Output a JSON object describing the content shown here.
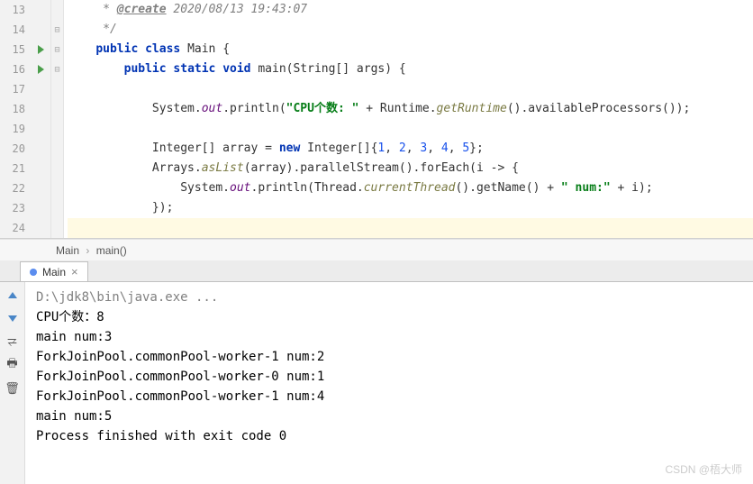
{
  "editor": {
    "lines": [
      {
        "n": 13,
        "run": false,
        "fold": "",
        "tokens": [
          {
            "t": "     * ",
            "c": "cmt"
          },
          {
            "t": "@create",
            "c": "anno"
          },
          {
            "t": " 2020/08/13 19:43:07",
            "c": "cmt"
          }
        ]
      },
      {
        "n": 14,
        "run": false,
        "fold": "⊟",
        "tokens": [
          {
            "t": "     */",
            "c": "cmt"
          }
        ]
      },
      {
        "n": 15,
        "run": true,
        "fold": "⊟",
        "tokens": [
          {
            "t": "    ",
            "c": ""
          },
          {
            "t": "public class ",
            "c": "kw"
          },
          {
            "t": "Main {",
            "c": "cls"
          }
        ]
      },
      {
        "n": 16,
        "run": true,
        "fold": "⊟",
        "tokens": [
          {
            "t": "        ",
            "c": ""
          },
          {
            "t": "public static void ",
            "c": "kw"
          },
          {
            "t": "main(String[] args) {",
            "c": "cls"
          }
        ]
      },
      {
        "n": 17,
        "run": false,
        "fold": "",
        "tokens": [
          {
            "t": "",
            "c": ""
          }
        ]
      },
      {
        "n": 18,
        "run": false,
        "fold": "",
        "tokens": [
          {
            "t": "            System.",
            "c": ""
          },
          {
            "t": "out",
            "c": "fld"
          },
          {
            "t": ".println(",
            "c": ""
          },
          {
            "t": "\"CPU个数: \"",
            "c": "str"
          },
          {
            "t": " + Runtime.",
            "c": ""
          },
          {
            "t": "getRuntime",
            "c": "mth"
          },
          {
            "t": "().availableProcessors());",
            "c": ""
          }
        ]
      },
      {
        "n": 19,
        "run": false,
        "fold": "",
        "tokens": [
          {
            "t": "",
            "c": ""
          }
        ]
      },
      {
        "n": 20,
        "run": false,
        "fold": "",
        "tokens": [
          {
            "t": "            Integer[] array = ",
            "c": ""
          },
          {
            "t": "new ",
            "c": "kw"
          },
          {
            "t": "Integer[]{",
            "c": ""
          },
          {
            "t": "1",
            "c": "num"
          },
          {
            "t": ", ",
            "c": ""
          },
          {
            "t": "2",
            "c": "num"
          },
          {
            "t": ", ",
            "c": ""
          },
          {
            "t": "3",
            "c": "num"
          },
          {
            "t": ", ",
            "c": ""
          },
          {
            "t": "4",
            "c": "num"
          },
          {
            "t": ", ",
            "c": ""
          },
          {
            "t": "5",
            "c": "num"
          },
          {
            "t": "};",
            "c": ""
          }
        ]
      },
      {
        "n": 21,
        "run": false,
        "fold": "",
        "tokens": [
          {
            "t": "            Arrays.",
            "c": ""
          },
          {
            "t": "asList",
            "c": "mth"
          },
          {
            "t": "(array).parallelStream().forEach(i -> {",
            "c": ""
          }
        ]
      },
      {
        "n": 22,
        "run": false,
        "fold": "",
        "tokens": [
          {
            "t": "                System.",
            "c": ""
          },
          {
            "t": "out",
            "c": "fld"
          },
          {
            "t": ".println(Thread.",
            "c": ""
          },
          {
            "t": "currentThread",
            "c": "mth"
          },
          {
            "t": "().getName() + ",
            "c": ""
          },
          {
            "t": "\" num:\"",
            "c": "str"
          },
          {
            "t": " + i);",
            "c": ""
          }
        ]
      },
      {
        "n": 23,
        "run": false,
        "fold": "",
        "tokens": [
          {
            "t": "            });",
            "c": ""
          }
        ]
      },
      {
        "n": 24,
        "run": false,
        "fold": "",
        "hl": true,
        "tokens": [
          {
            "t": "",
            "c": ""
          }
        ]
      }
    ]
  },
  "breadcrumb": {
    "parts": [
      "Main",
      "main()"
    ]
  },
  "run": {
    "tab": "Main",
    "command": "D:\\jdk8\\bin\\java.exe ...",
    "output": [
      "CPU个数：8",
      "main num:3",
      "ForkJoinPool.commonPool-worker-1 num:2",
      "ForkJoinPool.commonPool-worker-0 num:1",
      "ForkJoinPool.commonPool-worker-1 num:4",
      "main num:5"
    ],
    "exit": "Process finished with exit code 0"
  },
  "watermark": "CSDN @梧大师"
}
